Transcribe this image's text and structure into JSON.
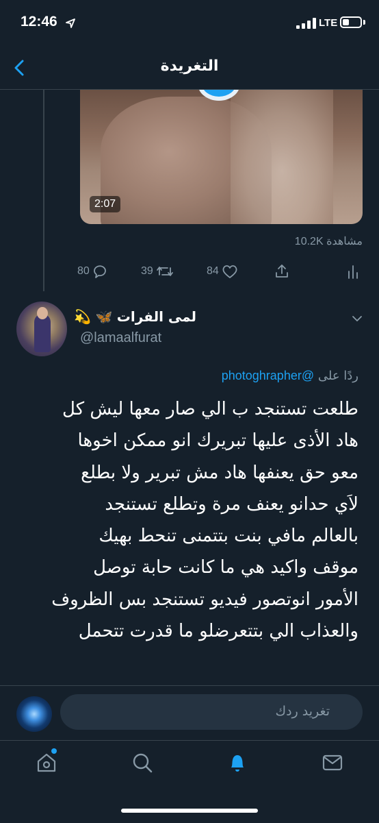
{
  "status_bar": {
    "time": "12:46",
    "network": "LTE"
  },
  "nav": {
    "title": "التغريدة"
  },
  "media": {
    "duration": "2:07"
  },
  "views": "10.2K مشاهدة",
  "actions": {
    "replies": "80",
    "retweets": "39",
    "likes": "84"
  },
  "tweet": {
    "name": "لمى الفرات",
    "name_emoji": "💫 🦋",
    "handle": "@lamaalfurat",
    "reply_prefix": "ردًا على",
    "reply_mention": "@photoghrapher",
    "lines": [
      "طلعت تستنجد ب الي صار معها ليش كل",
      "هاد الأذى عليها تبريرك انو ممكن اخوها",
      "معو حق يعنفها هاد مش تبرير ولا بطلع",
      "لاَي حدانو يعنف مرة وتطلع تستنجد",
      "بالعالم مافي بنت بتتمنى تنحط بهيك",
      "موقف واكيد هي ما كانت حابة توصل",
      "الأمور انوتصور فيديو تستنجد بس الظروف",
      "والعذاب الي بتتعرضلو ما قدرت تتحمل"
    ]
  },
  "reply_box": {
    "placeholder": "تغريد ردك"
  },
  "colors": {
    "background": "#15202b",
    "accent": "#1da1f2",
    "muted": "#8899a6",
    "divider": "#38444d"
  }
}
